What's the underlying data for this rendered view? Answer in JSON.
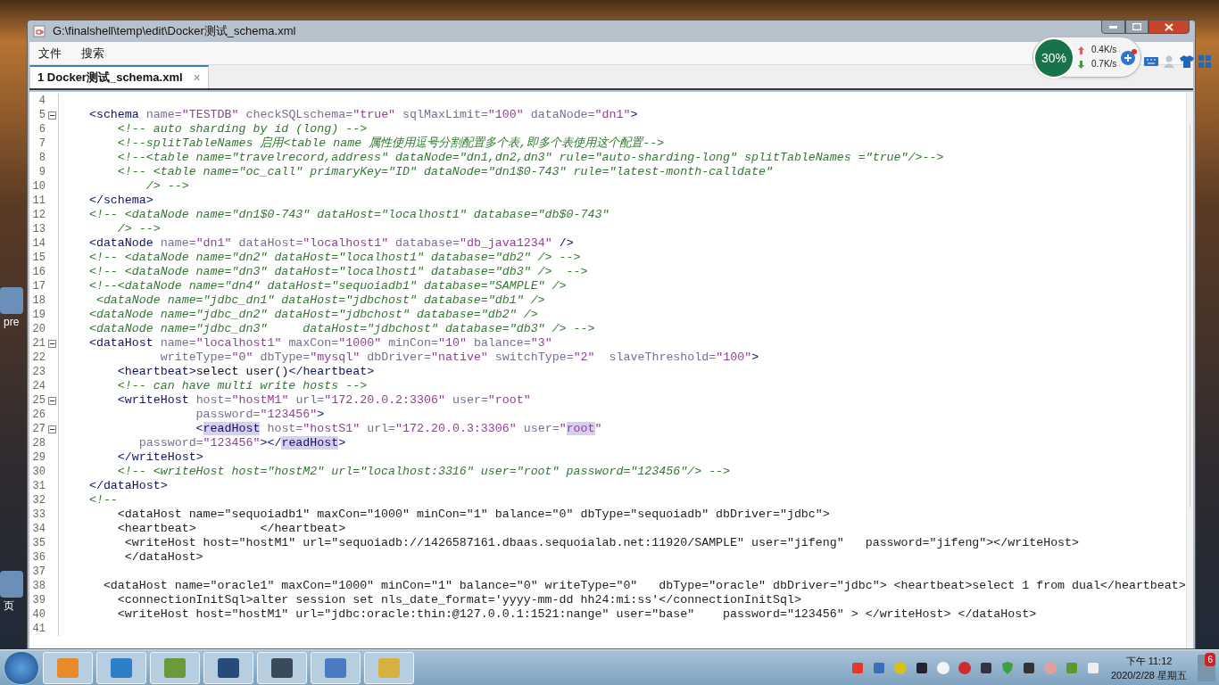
{
  "window": {
    "title": "G:\\finalshell\\temp\\edit\\Docker测试_schema.xml"
  },
  "menu": [
    {
      "label": "文件"
    },
    {
      "label": "搜索"
    }
  ],
  "tabs": [
    {
      "label": "1 Docker测试_schema.xml",
      "selected": true,
      "close": "×"
    }
  ],
  "editor": {
    "lines": [
      {
        "number": "4",
        "kind": "code",
        "fold": false
      },
      {
        "number": "5",
        "kind": "code",
        "fold": true,
        "text": "    <schema name=\"TESTDB\" checkSQLschema=\"true\" sqlMaxLimit=\"100\" dataNode=\"dn1\">"
      },
      {
        "number": "6",
        "kind": "comment",
        "fold": false,
        "text": "        <!-- auto sharding by id (long) -->"
      },
      {
        "number": "7",
        "kind": "comment",
        "fold": false,
        "text": "        <!--splitTableNames 启用<table name 属性使用逗号分割配置多个表,即多个表使用这个配置-->"
      },
      {
        "number": "8",
        "kind": "comment",
        "fold": false,
        "text": "        <!--<table name=\"travelrecord,address\" dataNode=\"dn1,dn2,dn3\" rule=\"auto-sharding-long\" splitTableNames =\"true\"/>-->"
      },
      {
        "number": "9",
        "kind": "comment",
        "fold": false,
        "text": "        <!-- <table name=\"oc_call\" primaryKey=\"ID\" dataNode=\"dn1$0-743\" rule=\"latest-month-calldate\""
      },
      {
        "number": "10",
        "kind": "comment",
        "fold": false,
        "text": "            /> -->"
      },
      {
        "number": "11",
        "kind": "code",
        "fold": false,
        "text": "    </schema>"
      },
      {
        "number": "12",
        "kind": "comment",
        "fold": false,
        "text": "    <!-- <dataNode name=\"dn1$0-743\" dataHost=\"localhost1\" database=\"db$0-743\""
      },
      {
        "number": "13",
        "kind": "comment",
        "fold": false,
        "text": "        /> -->"
      },
      {
        "number": "14",
        "kind": "code",
        "fold": false,
        "text": "    <dataNode name=\"dn1\" dataHost=\"localhost1\" database=\"db_java1234\" />"
      },
      {
        "number": "15",
        "kind": "comment",
        "fold": false,
        "text": "    <!-- <dataNode name=\"dn2\" dataHost=\"localhost1\" database=\"db2\" /> -->"
      },
      {
        "number": "16",
        "kind": "comment",
        "fold": false,
        "text": "    <!-- <dataNode name=\"dn3\" dataHost=\"localhost1\" database=\"db3\" />  -->"
      },
      {
        "number": "17",
        "kind": "comment",
        "fold": false,
        "text": "    <!--<dataNode name=\"dn4\" dataHost=\"sequoiadb1\" database=\"SAMPLE\" />"
      },
      {
        "number": "18",
        "kind": "comment",
        "fold": false,
        "text": "     <dataNode name=\"jdbc_dn1\" dataHost=\"jdbchost\" database=\"db1\" />"
      },
      {
        "number": "19",
        "kind": "comment",
        "fold": false,
        "text": "    <dataNode name=\"jdbc_dn2\" dataHost=\"jdbchost\" database=\"db2\" />"
      },
      {
        "number": "20",
        "kind": "comment",
        "fold": false,
        "text": "    <dataNode name=\"jdbc_dn3\"     dataHost=\"jdbchost\" database=\"db3\" /> -->"
      },
      {
        "number": "21",
        "kind": "code",
        "fold": true,
        "text": "    <dataHost name=\"localhost1\" maxCon=\"1000\" minCon=\"10\" balance=\"3\""
      },
      {
        "number": "22",
        "kind": "code",
        "fold": false,
        "text": "              writeType=\"0\" dbType=\"mysql\" dbDriver=\"native\" switchType=\"2\"  slaveThreshold=\"100\">"
      },
      {
        "number": "23",
        "kind": "code",
        "fold": false,
        "text": "        <heartbeat>select user()</heartbeat>"
      },
      {
        "number": "24",
        "kind": "comment",
        "fold": false,
        "text": "        <!-- can have multi write hosts -->"
      },
      {
        "number": "25",
        "kind": "code",
        "fold": true,
        "text": "        <writeHost host=\"hostM1\" url=\"172.20.0.2:3306\" user=\"root\""
      },
      {
        "number": "26",
        "kind": "code",
        "fold": false,
        "text": "                   password=\"123456\">"
      },
      {
        "number": "27",
        "kind": "code",
        "fold": true,
        "segments": [
          {
            "text": "                   <",
            "highlighted": false
          },
          {
            "text": "readHost",
            "highlighted": true
          },
          {
            "text": " host=\"hostS1\" url=\"172.20.0.3:3306\" user=\"",
            "highlighted": false
          },
          {
            "text": "root",
            "highlighted": true
          },
          {
            "text": "\"",
            "highlighted": false
          }
        ]
      },
      {
        "number": "28",
        "kind": "code",
        "fold": false,
        "segments": [
          {
            "text": "           password=\"123456\"></",
            "highlighted": false
          },
          {
            "text": "readHost",
            "highlighted": true
          },
          {
            "text": ">",
            "highlighted": false
          }
        ]
      },
      {
        "number": "29",
        "kind": "code",
        "fold": false,
        "text": "        </writeHost>"
      },
      {
        "number": "30",
        "kind": "comment",
        "fold": false,
        "text": "        <!-- <writeHost host=\"hostM2\" url=\"localhost:3316\" user=\"root\" password=\"123456\"/> -->"
      },
      {
        "number": "31",
        "kind": "code",
        "fold": false,
        "text": "    </dataHost>"
      },
      {
        "number": "32",
        "kind": "comment",
        "fold": false,
        "text": "    <!--"
      },
      {
        "number": "33",
        "kind": "plain",
        "fold": false,
        "text": "        <dataHost name=\"sequoiadb1\" maxCon=\"1000\" minCon=\"1\" balance=\"0\" dbType=\"sequoiadb\" dbDriver=\"jdbc\">"
      },
      {
        "number": "34",
        "kind": "plain",
        "fold": false,
        "text": "        <heartbeat>         </heartbeat>"
      },
      {
        "number": "35",
        "kind": "plain",
        "fold": false,
        "text": "         <writeHost host=\"hostM1\" url=\"sequoiadb://1426587161.dbaas.sequoialab.net:11920/SAMPLE\" user=\"jifeng\"   password=\"jifeng\"></writeHost>"
      },
      {
        "number": "36",
        "kind": "plain",
        "fold": false,
        "text": "         </dataHost>"
      },
      {
        "number": "37",
        "kind": "plain",
        "fold": false
      },
      {
        "number": "38",
        "kind": "plain",
        "fold": false,
        "text": "      <dataHost name=\"oracle1\" maxCon=\"1000\" minCon=\"1\" balance=\"0\" writeType=\"0\"   dbType=\"oracle\" dbDriver=\"jdbc\"> <heartbeat>select 1 from dual</heartbeat>"
      },
      {
        "number": "39",
        "kind": "plain",
        "fold": false,
        "text": "        <connectionInitSql>alter session set nls_date_format='yyyy-mm-dd hh24:mi:ss'</connectionInitSql>"
      },
      {
        "number": "40",
        "kind": "plain",
        "fold": false,
        "text": "        <writeHost host=\"hostM1\" url=\"jdbc:oracle:thin:@127.0.0.1:1521:nange\" user=\"base\"    password=\"123456\" > </writeHost> </dataHost>"
      },
      {
        "number": "41",
        "kind": "plain",
        "fold": false
      }
    ]
  },
  "network_monitor": {
    "percent": "30%",
    "upload": "0.4K/s",
    "download": "0.7K/s"
  },
  "desktop_labels": [
    "pre",
    "页"
  ],
  "taskbar": {
    "time": "下午 11:12",
    "date": "2020/2/28 星期五",
    "badge": "6"
  }
}
